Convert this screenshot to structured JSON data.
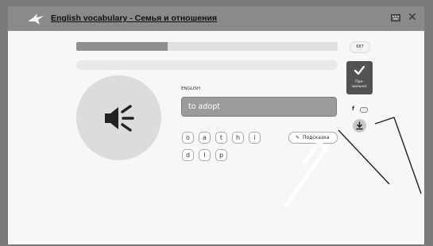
{
  "header": {
    "title": "English vocabulary - Семья и отношения",
    "logo_icon": "bird-logo-icon",
    "keyboard_icon": "keyboard-icon",
    "close_label": "✕"
  },
  "progress": {
    "fraction": 0.35
  },
  "counter": {
    "text": "687"
  },
  "exercise": {
    "language_label": "ENGLISH",
    "answer_value": "to adopt",
    "speaker_icon": "speaker-icon",
    "letters_row1": [
      "o",
      "a",
      "t",
      "h",
      "i"
    ],
    "letters_row2": [
      "d",
      "l",
      "p"
    ],
    "hint_label": "Подсказка",
    "hint_icon": "wand-icon"
  },
  "check": {
    "label_line1": "Пра-",
    "label_line2": "вильно!",
    "icon": "check-icon"
  },
  "side": {
    "facebook_label": "f",
    "toggle_icon": "toggle-icon",
    "download_icon": "download-icon"
  },
  "colors": {
    "title_bar": "#8a8a8a",
    "progress_fill": "#8f8f8f",
    "answer_field": "#9b9b9b",
    "check_button": "#525252"
  }
}
